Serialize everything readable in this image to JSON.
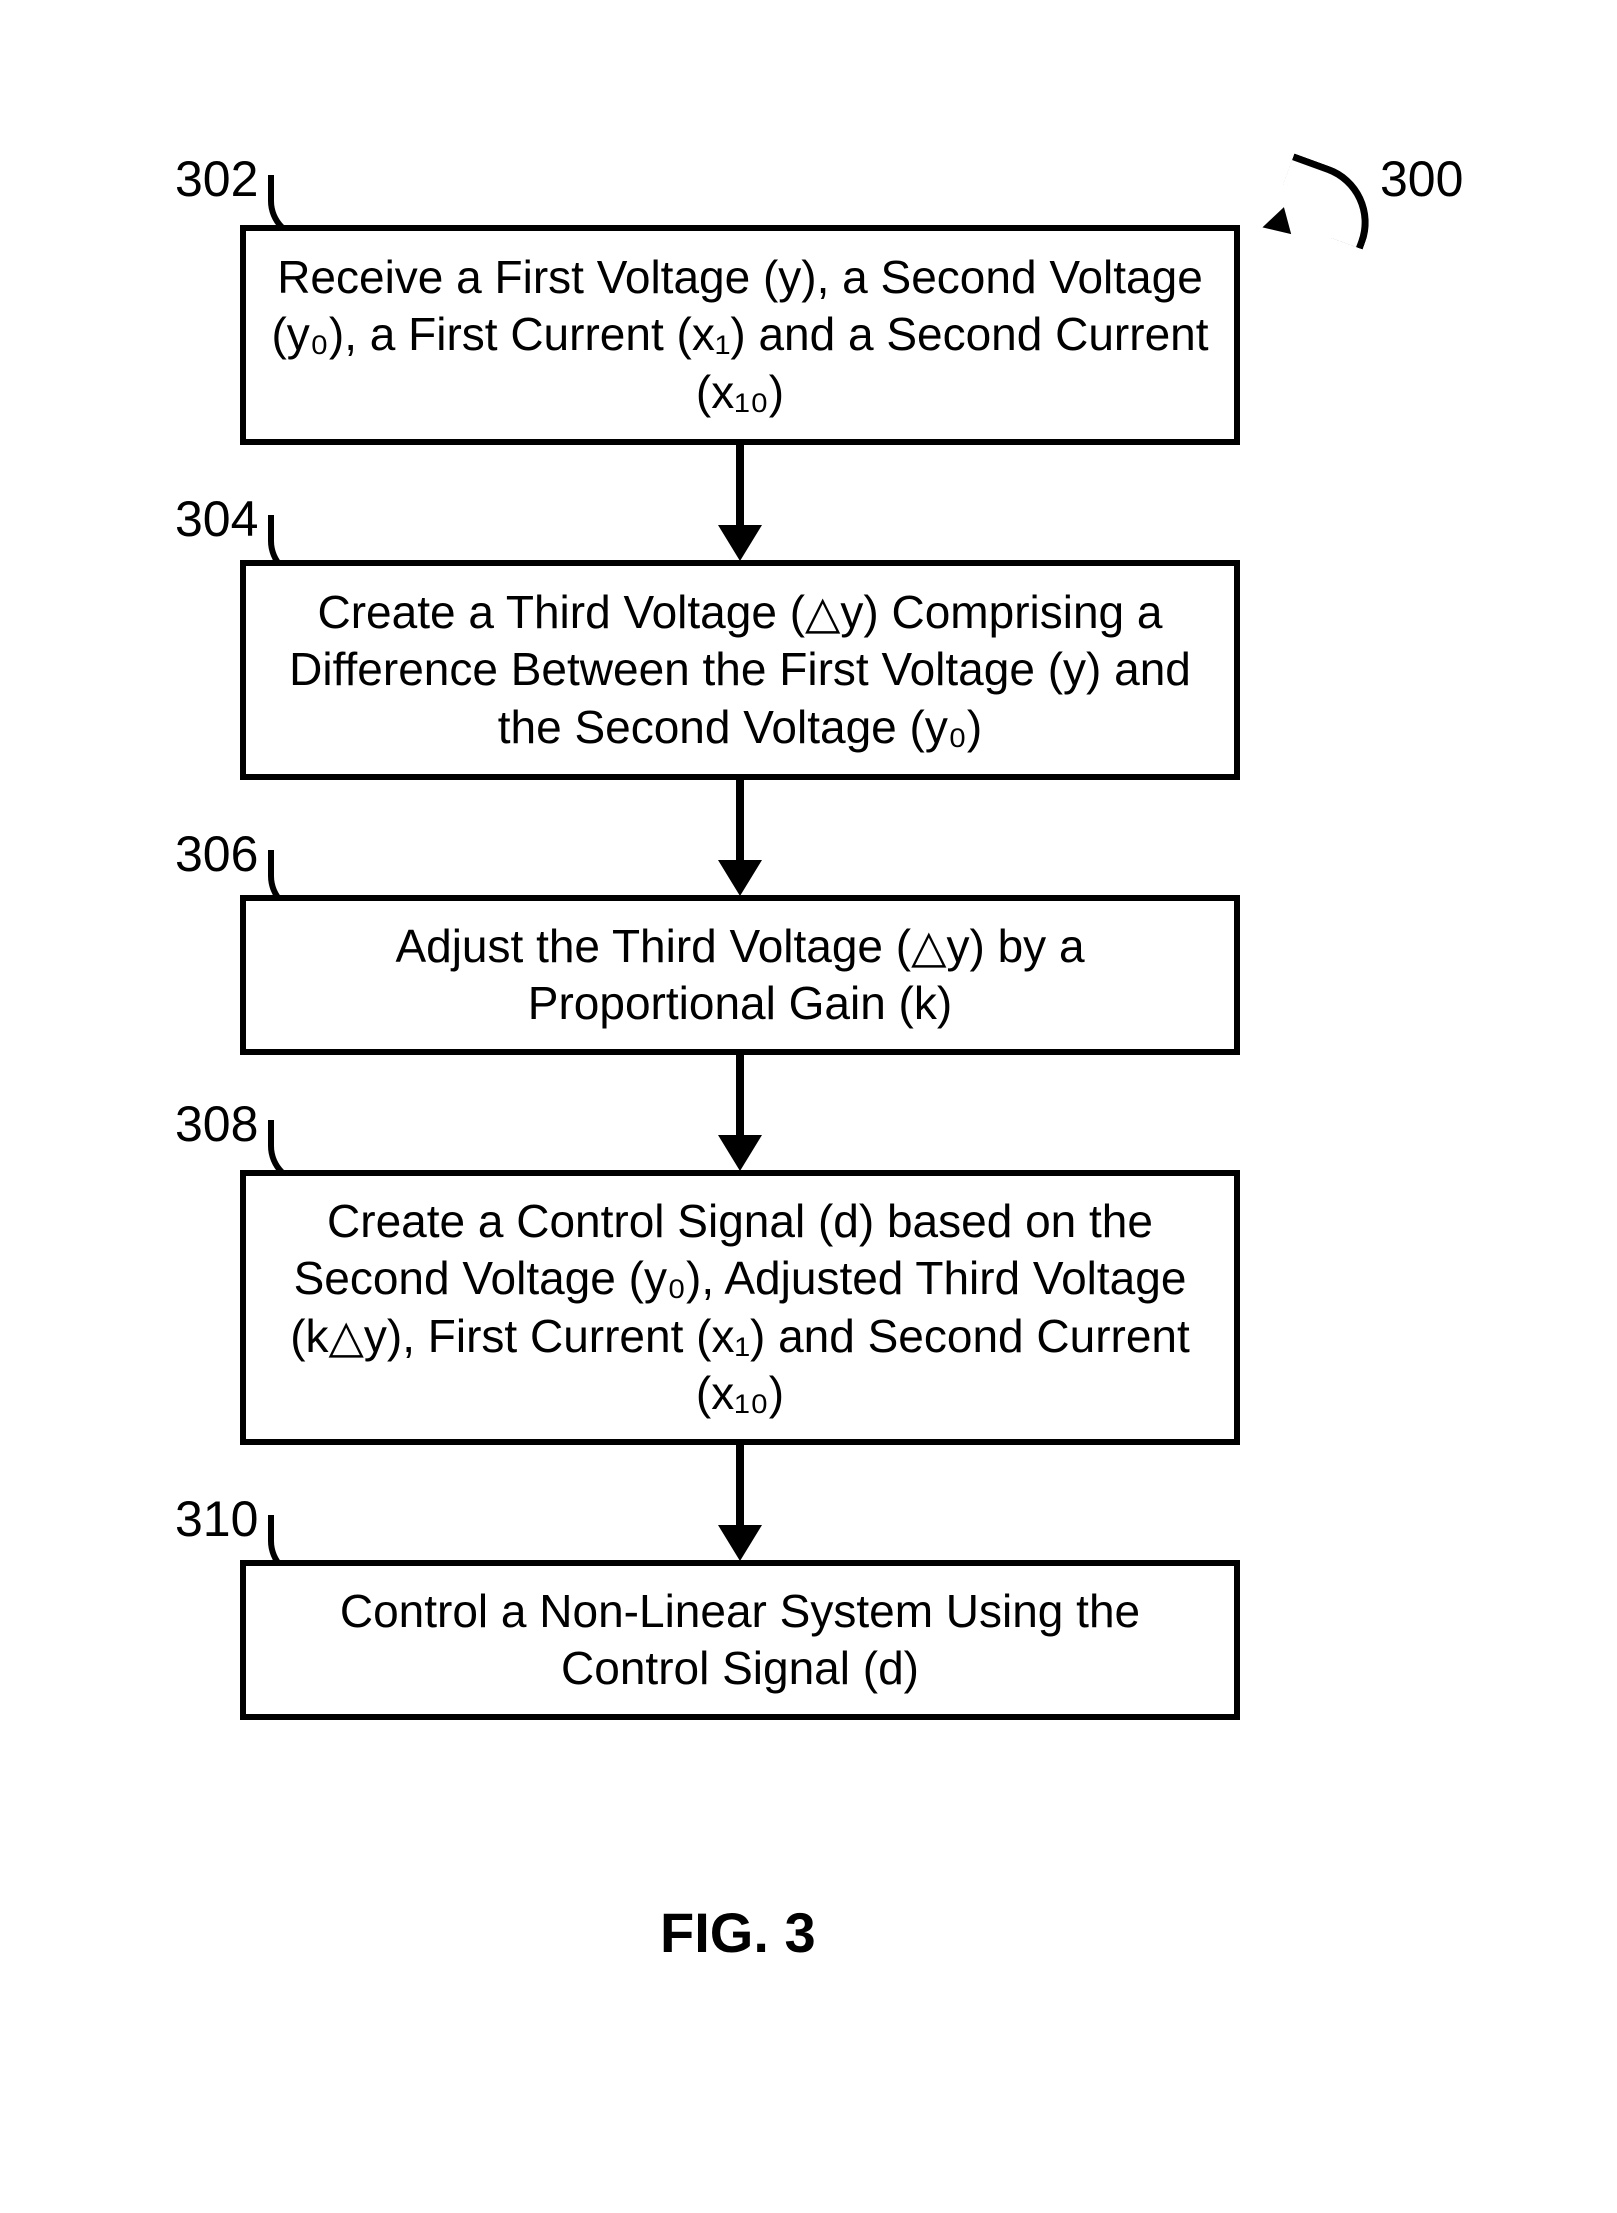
{
  "chart_data": {
    "type": "flowchart",
    "title": "FIG. 3",
    "diagram_ref": "300",
    "steps": [
      {
        "ref": "302",
        "text": "Receive a First Voltage (y), a Second Voltage (y₀), a First Current (x₁) and a Second Current (x₁₀)"
      },
      {
        "ref": "304",
        "text": "Create a Third Voltage (△y) Comprising a Difference Between the First Voltage (y) and the Second Voltage (y₀)"
      },
      {
        "ref": "306",
        "text": "Adjust the Third Voltage (△y) by a Proportional Gain (k)"
      },
      {
        "ref": "308",
        "text": "Create a Control Signal (d) based on the Second Voltage (y₀), Adjusted Third Voltage (k△y), First Current (x₁) and Second Current (x₁₀)"
      },
      {
        "ref": "310",
        "text": "Control a Non-Linear System Using the Control Signal (d)"
      }
    ],
    "edges": [
      {
        "from": "302",
        "to": "304"
      },
      {
        "from": "304",
        "to": "306"
      },
      {
        "from": "306",
        "to": "308"
      },
      {
        "from": "308",
        "to": "310"
      }
    ]
  },
  "labels": {
    "fig": "FIG. 3",
    "ref300": "300",
    "ref302": "302",
    "ref304": "304",
    "ref306": "306",
    "ref308": "308",
    "ref310": "310"
  },
  "boxes": {
    "b302": "Receive a First Voltage (y), a Second Voltage (y₀), a First Current (x₁) and a Second Current (x₁₀)",
    "b304": "Create a Third Voltage (△y) Comprising a Difference Between the First Voltage (y) and the Second Voltage (y₀)",
    "b306": "Adjust the Third Voltage (△y) by a Proportional Gain (k)",
    "b308": "Create a Control Signal (d) based on the Second Voltage (y₀), Adjusted Third Voltage (k△y), First Current (x₁) and Second Current (x₁₀)",
    "b310": "Control a Non-Linear System Using the Control Signal (d)"
  }
}
